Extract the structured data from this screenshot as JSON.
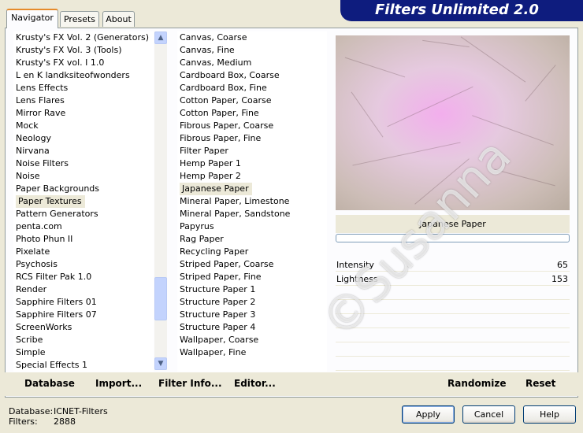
{
  "tabs": [
    {
      "label": "Navigator",
      "active": true
    },
    {
      "label": "Presets",
      "active": false
    },
    {
      "label": "About",
      "active": false
    }
  ],
  "banner": {
    "title": "Filters Unlimited 2.0",
    "color": "#0e1c7e"
  },
  "categories": {
    "items": [
      "Krusty's FX Vol. 2 (Generators)",
      "Krusty's FX Vol. 3 (Tools)",
      "Krusty's FX vol. I 1.0",
      "L en K landksiteofwonders",
      "Lens Effects",
      "Lens Flares",
      "Mirror Rave",
      "Mock",
      "Neology",
      "Nirvana",
      "Noise Filters",
      "Noise",
      "Paper Backgrounds",
      "Paper Textures",
      "Pattern Generators",
      "penta.com",
      "Photo Phun II",
      "Pixelate",
      "Psychosis",
      "RCS Filter Pak 1.0",
      "Render",
      "Sapphire Filters 01",
      "Sapphire Filters 07",
      "ScreenWorks",
      "Scribe",
      "Simple",
      "Special Effects 1"
    ],
    "selected": "Paper Textures"
  },
  "filters": {
    "items": [
      "Canvas, Coarse",
      "Canvas, Fine",
      "Canvas, Medium",
      "Cardboard Box, Coarse",
      "Cardboard Box, Fine",
      "Cotton Paper, Coarse",
      "Cotton Paper, Fine",
      "Fibrous Paper, Coarse",
      "Fibrous Paper, Fine",
      "Filter Paper",
      "Hemp Paper 1",
      "Hemp Paper 2",
      "Japanese Paper",
      "Mineral Paper, Limestone",
      "Mineral Paper, Sandstone",
      "Papyrus",
      "Rag Paper",
      "Recycling Paper",
      "Striped Paper, Coarse",
      "Striped Paper, Fine",
      "Structure Paper 1",
      "Structure Paper 2",
      "Structure Paper 3",
      "Structure Paper 4",
      "Wallpaper, Coarse",
      "Wallpaper, Fine"
    ],
    "selected": "Japanese Paper"
  },
  "preview": {
    "caption": "Japanese Paper"
  },
  "parameters": [
    {
      "label": "Intensity",
      "value": "65"
    },
    {
      "label": "Lightness",
      "value": "153"
    }
  ],
  "bottom_buttons": {
    "database": "Database",
    "import": "Import...",
    "filter_info": "Filter Info...",
    "editor": "Editor...",
    "randomize": "Randomize",
    "reset": "Reset"
  },
  "status": {
    "database_label": "Database:",
    "database_value": "ICNET-Filters",
    "filters_label": "Filters:",
    "filters_value": "2888"
  },
  "dialog_buttons": {
    "apply": "Apply",
    "cancel": "Cancel",
    "help": "Help"
  },
  "watermark": "©Susanna"
}
